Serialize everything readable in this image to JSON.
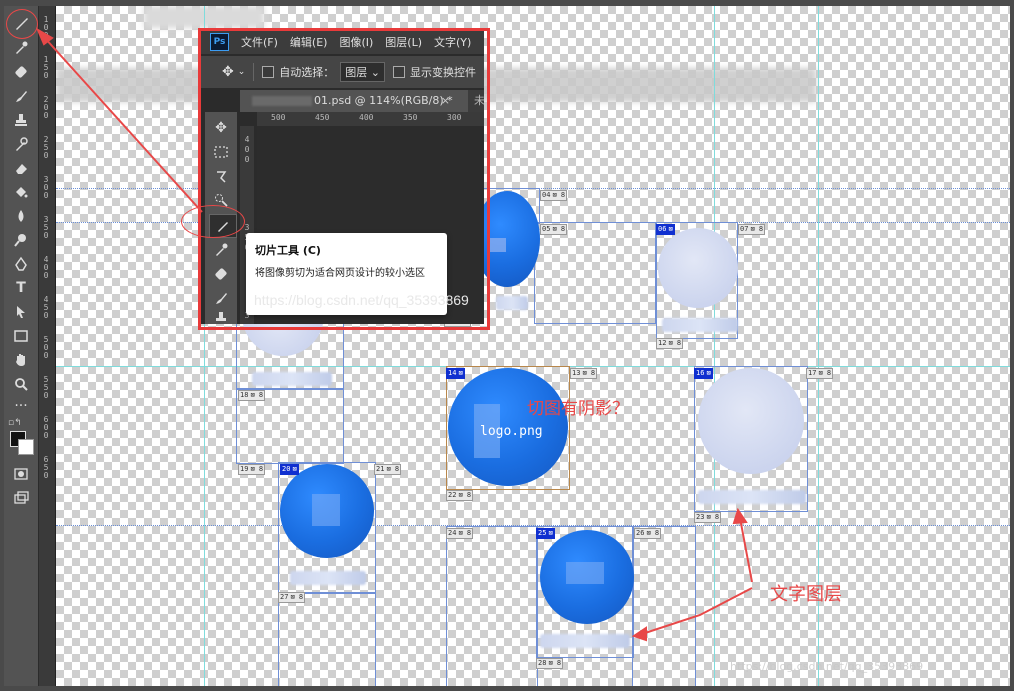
{
  "photoshop": {
    "logo": "Ps",
    "menu": [
      "文件(F)",
      "编辑(E)",
      "图像(I)",
      "图层(L)",
      "文字(Y)"
    ],
    "options": {
      "auto_select_label": "自动选择：",
      "auto_select_value": "图层",
      "show_transform_label": "显示变换控件"
    },
    "tab": {
      "label": "01.psd @ 114%(RGB/8) *",
      "close": "×",
      "next_tab": "未"
    },
    "ruler_h": [
      "500",
      "450",
      "400",
      "350",
      "300"
    ],
    "ruler_v": [
      "4",
      "0",
      "0",
      "3",
      "5",
      "0",
      "3"
    ]
  },
  "tooltip": {
    "title": "切片工具 (C)",
    "description": "将图像剪切为适合网页设计的较小选区"
  },
  "watermark": "https://blog.csdn.net/qq_35393869",
  "annotations": {
    "shadow_question": "切图有阴影？",
    "text_layer": "文字图层",
    "logo_label": "logo.png"
  },
  "slices": {
    "s04": "04",
    "s05": "05",
    "s06": "06",
    "s07": "07",
    "s11": "11",
    "s12": "12",
    "s13": "13",
    "s14": "14",
    "s16": "16",
    "s17": "17",
    "s18": "18",
    "s19": "19",
    "s20": "20",
    "s21": "21",
    "s22": "22",
    "s23": "23",
    "s24": "24",
    "s25": "25",
    "s26": "26",
    "s27": "27",
    "s28": "28"
  },
  "left_ruler": [
    "1",
    "0",
    "0",
    "1",
    "5",
    "0",
    "2",
    "0",
    "0",
    "2",
    "5",
    "0",
    "3",
    "0",
    "0",
    "3",
    "5",
    "0",
    "4",
    "0",
    "0",
    "4",
    "5",
    "0",
    "5",
    "0",
    "0",
    "5",
    "5",
    "0",
    "6",
    "0",
    "0",
    "6",
    "5",
    "0"
  ],
  "bottom_watermark": "https://blog.csdn.net/qq_35393869",
  "colors": {
    "accent_red": "#e84848",
    "slice_user": "#1030d0",
    "logo_blue": "#1a6de0"
  }
}
